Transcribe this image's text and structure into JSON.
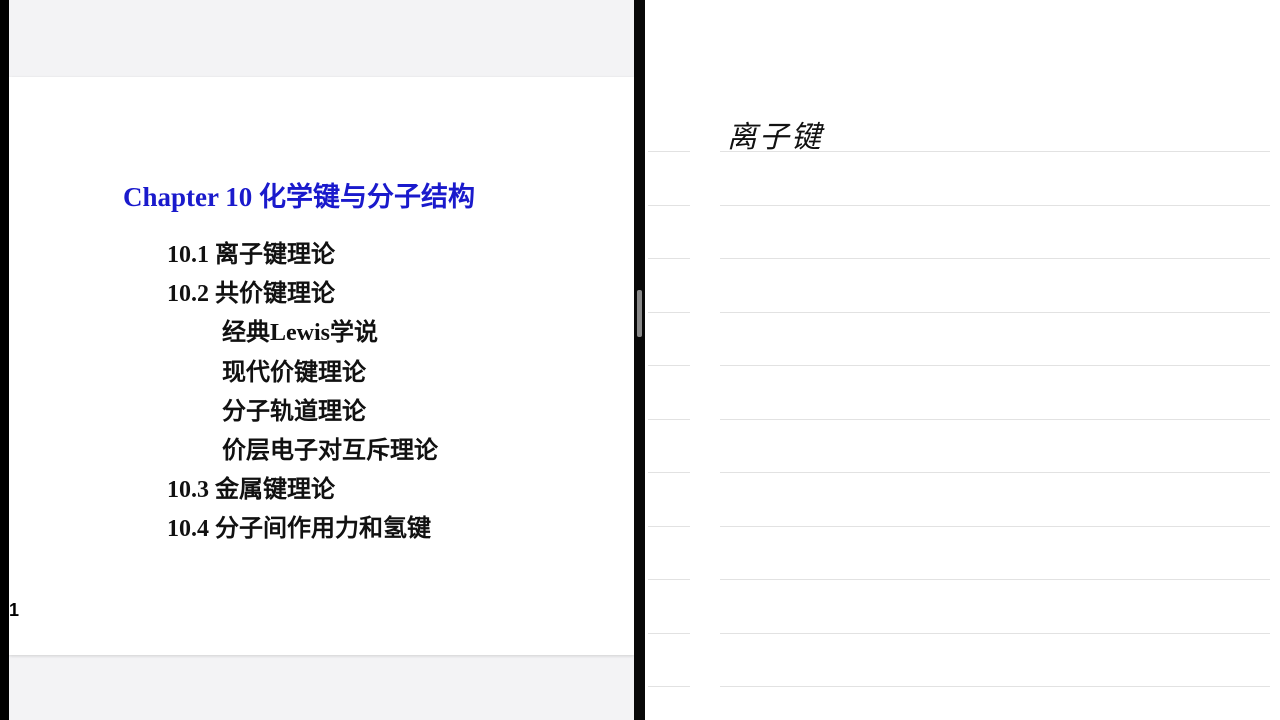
{
  "slide": {
    "title": "Chapter 10 化学键与分子结构",
    "items": [
      {
        "text": "10.1 离子键理论",
        "indent": 0
      },
      {
        "text": "10.2 共价键理论",
        "indent": 0
      },
      {
        "text": "经典Lewis学说",
        "indent": 1
      },
      {
        "text": "现代价键理论",
        "indent": 1
      },
      {
        "text": "分子轨道理论",
        "indent": 1
      },
      {
        "text": "价层电子对互斥理论",
        "indent": 1
      },
      {
        "text": "10.3 金属键理论",
        "indent": 0
      },
      {
        "text": "10.4 分子间作用力和氢键",
        "indent": 0
      }
    ],
    "page_number": "1"
  },
  "notes": {
    "handwriting": "离子键"
  }
}
